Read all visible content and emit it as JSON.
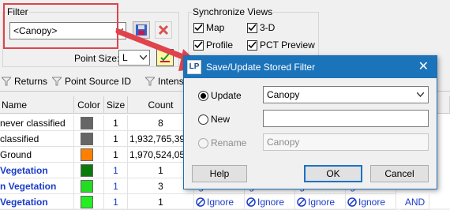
{
  "filter": {
    "group_title": "Filter",
    "selected": "<Canopy>",
    "point_size_label": "Point Size:",
    "point_size_value": "L"
  },
  "sync": {
    "title": "Synchronize Views",
    "items": [
      {
        "label": "Map",
        "checked": true
      },
      {
        "label": "3-D",
        "checked": true
      },
      {
        "label": "Profile",
        "checked": true
      },
      {
        "label": "PCT Preview",
        "checked": true
      }
    ]
  },
  "tabs": [
    {
      "label": "Returns",
      "icon": "funnel-icon"
    },
    {
      "label": "Point Source ID",
      "icon": "funnel-icon"
    },
    {
      "label": "Intensi",
      "icon": "funnel-icon"
    }
  ],
  "table": {
    "columns": [
      "Name",
      "Color",
      "Size",
      "Count"
    ],
    "rows": [
      {
        "name": "never classified",
        "color": "#666666",
        "size": "1",
        "count": "8",
        "bold": false
      },
      {
        "name": "classified",
        "color": "#666666",
        "size": "1",
        "count": "1,932,765,39",
        "bold": false
      },
      {
        "name": "Ground",
        "color": "#ff8000",
        "size": "1",
        "count": "1,970,524,05",
        "bold": false
      },
      {
        "name": "Vegetation",
        "color": "#0a7a0a",
        "size": "1",
        "count": "1",
        "bold": true
      },
      {
        "name": "n Vegetation",
        "color": "#22dd22",
        "size": "1",
        "count": "3",
        "bold": true
      },
      {
        "name": "Vegetation",
        "color": "#22ee22",
        "size": "1",
        "count": "1",
        "bold": true
      }
    ],
    "bottom_cells": [
      "Ignore",
      "Ignore",
      "Ignore",
      "Ignore"
    ],
    "bottom_and": "AND",
    "partial_cells": [
      "Ig",
      "Ig",
      "Ig",
      "Ig"
    ]
  },
  "dialog": {
    "title": "Save/Update Stored Filter",
    "icon_text": "LP",
    "update_label": "Update",
    "update_value": "Canopy",
    "new_label": "New",
    "new_value": "",
    "rename_label": "Rename",
    "rename_value": "Canopy",
    "help_label": "Help",
    "ok_label": "OK",
    "cancel_label": "Cancel"
  },
  "colors": {
    "highlight": "#e0434b",
    "arrow": "#e0434b",
    "title_bar": "#1b73ba",
    "link": "#1a3cc8"
  }
}
